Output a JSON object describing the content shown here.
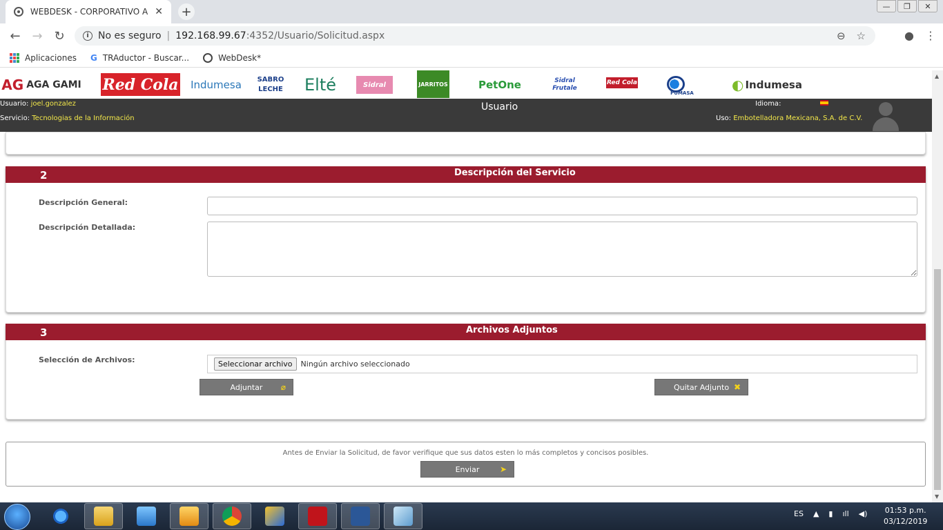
{
  "browser": {
    "tab_title": "WEBDESK - CORPORATIVO AGA",
    "tab_close": "✕",
    "new_tab": "+",
    "security_label": "No es seguro",
    "url_host": "192.168.99.67",
    "url_path": ":4352/Usuario/Solicitud.aspx",
    "window_controls": [
      "—",
      "❐",
      "✕"
    ]
  },
  "bookmarks": [
    {
      "label": "Aplicaciones",
      "icon": "apps-grid-icon"
    },
    {
      "label": "TRAductor - Buscar...",
      "icon": "google-icon"
    },
    {
      "label": "WebDesk*",
      "icon": "globe-icon"
    }
  ],
  "logos": [
    {
      "text": "AGA GAMI",
      "color": "#333333"
    },
    {
      "text": "Red Cola",
      "color": "#ffffff",
      "bg": "#d8232a"
    },
    {
      "text": "Indumesa",
      "color": "#2a77b8"
    },
    {
      "text": "SABRO LECHE",
      "color": "#1c3f8a"
    },
    {
      "text": "Elté",
      "color": "#1e7f5f"
    },
    {
      "text": "Sidral",
      "color": "#ffffff",
      "bg": "#e78ab0"
    },
    {
      "text": "JARRITOS",
      "color": "#ffffff",
      "bg": "#3c8a26"
    },
    {
      "text": "PetOne",
      "color": "#2b9b3a"
    },
    {
      "text": "Sidral Frutale",
      "color": "#2a4fb0"
    },
    {
      "text": "Red Cola",
      "color": "#ffffff",
      "bg": "#c21e2c"
    },
    {
      "text": "PUMASA",
      "color": "#1a3f8a"
    },
    {
      "text": "Indumesa",
      "color": "#333333"
    }
  ],
  "header": {
    "usuario_label": "Usuario:",
    "usuario_value": "joel.gonzalez",
    "servicio_label": "Servicio:",
    "servicio_value": "Tecnologias de la Información",
    "title": "Usuario",
    "idioma_label": "Idioma:",
    "uso_label": "Uso:",
    "uso_value": "Embotelladora Mexicana, S.A. de C.V."
  },
  "section2": {
    "number": "2",
    "title": "Descripción del Servicio",
    "general_label": "Descripción General:",
    "general_value": "",
    "detallada_label": "Descripción Detallada:",
    "detallada_value": ""
  },
  "section3": {
    "number": "3",
    "title": "Archivos Adjuntos",
    "files_label": "Selección de Archivos:",
    "file_button": "Seleccionar archivo",
    "file_status": "Ningún archivo seleccionado",
    "attach_button": "Adjuntar",
    "remove_button": "Quitar Adjunto"
  },
  "footer": {
    "note": "Antes de Enviar la Solicitud, de favor verifique que sus datos esten lo más completos y concisos posibles.",
    "send_button": "Enviar"
  },
  "taskbar": {
    "lang": "ES",
    "time": "01:53 p.m.",
    "date": "03/12/2019"
  },
  "colors": {
    "section_header": "#9b1c2e",
    "user_bar": "#3a3a3a",
    "highlight_text": "#f3e84a",
    "button_gray": "#777777"
  }
}
